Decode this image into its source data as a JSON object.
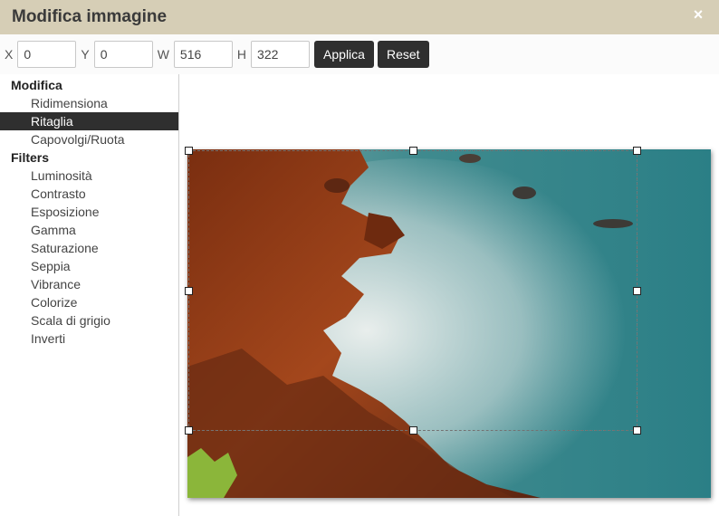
{
  "dialog": {
    "title": "Modifica immagine",
    "close_glyph": "×"
  },
  "toolbar": {
    "x_label": "X",
    "x_value": "0",
    "y_label": "Y",
    "y_value": "0",
    "w_label": "W",
    "w_value": "516",
    "h_label": "H",
    "h_value": "322",
    "apply_label": "Applica",
    "reset_label": "Reset"
  },
  "sidebar": {
    "sections": [
      {
        "title": "Modifica",
        "items": [
          {
            "label": "Ridimensiona",
            "active": false
          },
          {
            "label": "Ritaglia",
            "active": true
          },
          {
            "label": "Capovolgi/Ruota",
            "active": false
          }
        ]
      },
      {
        "title": "Filters",
        "items": [
          {
            "label": "Luminosità",
            "active": false
          },
          {
            "label": "Contrasto",
            "active": false
          },
          {
            "label": "Esposizione",
            "active": false
          },
          {
            "label": "Gamma",
            "active": false
          },
          {
            "label": "Saturazione",
            "active": false
          },
          {
            "label": "Seppia",
            "active": false
          },
          {
            "label": "Vibrance",
            "active": false
          },
          {
            "label": "Colorize",
            "active": false
          },
          {
            "label": "Scala di grigio",
            "active": false
          },
          {
            "label": "Inverti",
            "active": false
          }
        ]
      }
    ]
  },
  "colors": {
    "titlebar_bg": "#d6ceb6",
    "button_bg": "#2f2f2f",
    "active_item_bg": "#2f2f2f",
    "rock": "#8a3a16",
    "sea": "#3f8a8e",
    "mist": "#cfe0e0"
  }
}
